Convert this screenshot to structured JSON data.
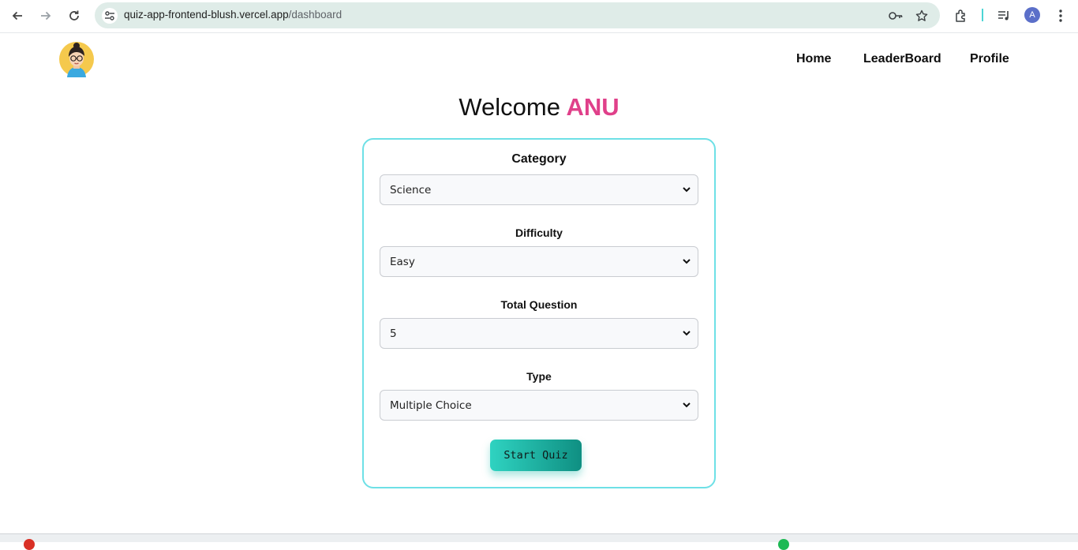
{
  "browser": {
    "url_host": "quiz-app-frontend-blush.vercel.app",
    "url_path": "/dashboard",
    "profile_initial": "A",
    "icons": [
      "back-icon",
      "forward-icon",
      "reload-icon",
      "site-settings-icon",
      "password-key-icon",
      "bookmark-star-icon",
      "extensions-icon",
      "media-queue-icon",
      "profile-avatar",
      "more-menu-icon"
    ]
  },
  "header": {
    "nav": [
      "Home",
      "LeaderBoard",
      "Profile"
    ]
  },
  "welcome": {
    "prefix": "Welcome",
    "name": "ANU"
  },
  "form": {
    "category": {
      "label": "Category",
      "value": "Science"
    },
    "difficulty": {
      "label": "Difficulty",
      "value": "Easy"
    },
    "total_question": {
      "label": "Total Question",
      "value": "5"
    },
    "type": {
      "label": "Type",
      "value": "Multiple Choice"
    },
    "submit_label": "Start Quiz"
  },
  "colors": {
    "accent_name": "#e0408a",
    "card_border": "#6ee0e6",
    "button_start": "#2fd3c1",
    "button_end": "#0f8f82",
    "omnibox_bg": "#dfece8"
  }
}
